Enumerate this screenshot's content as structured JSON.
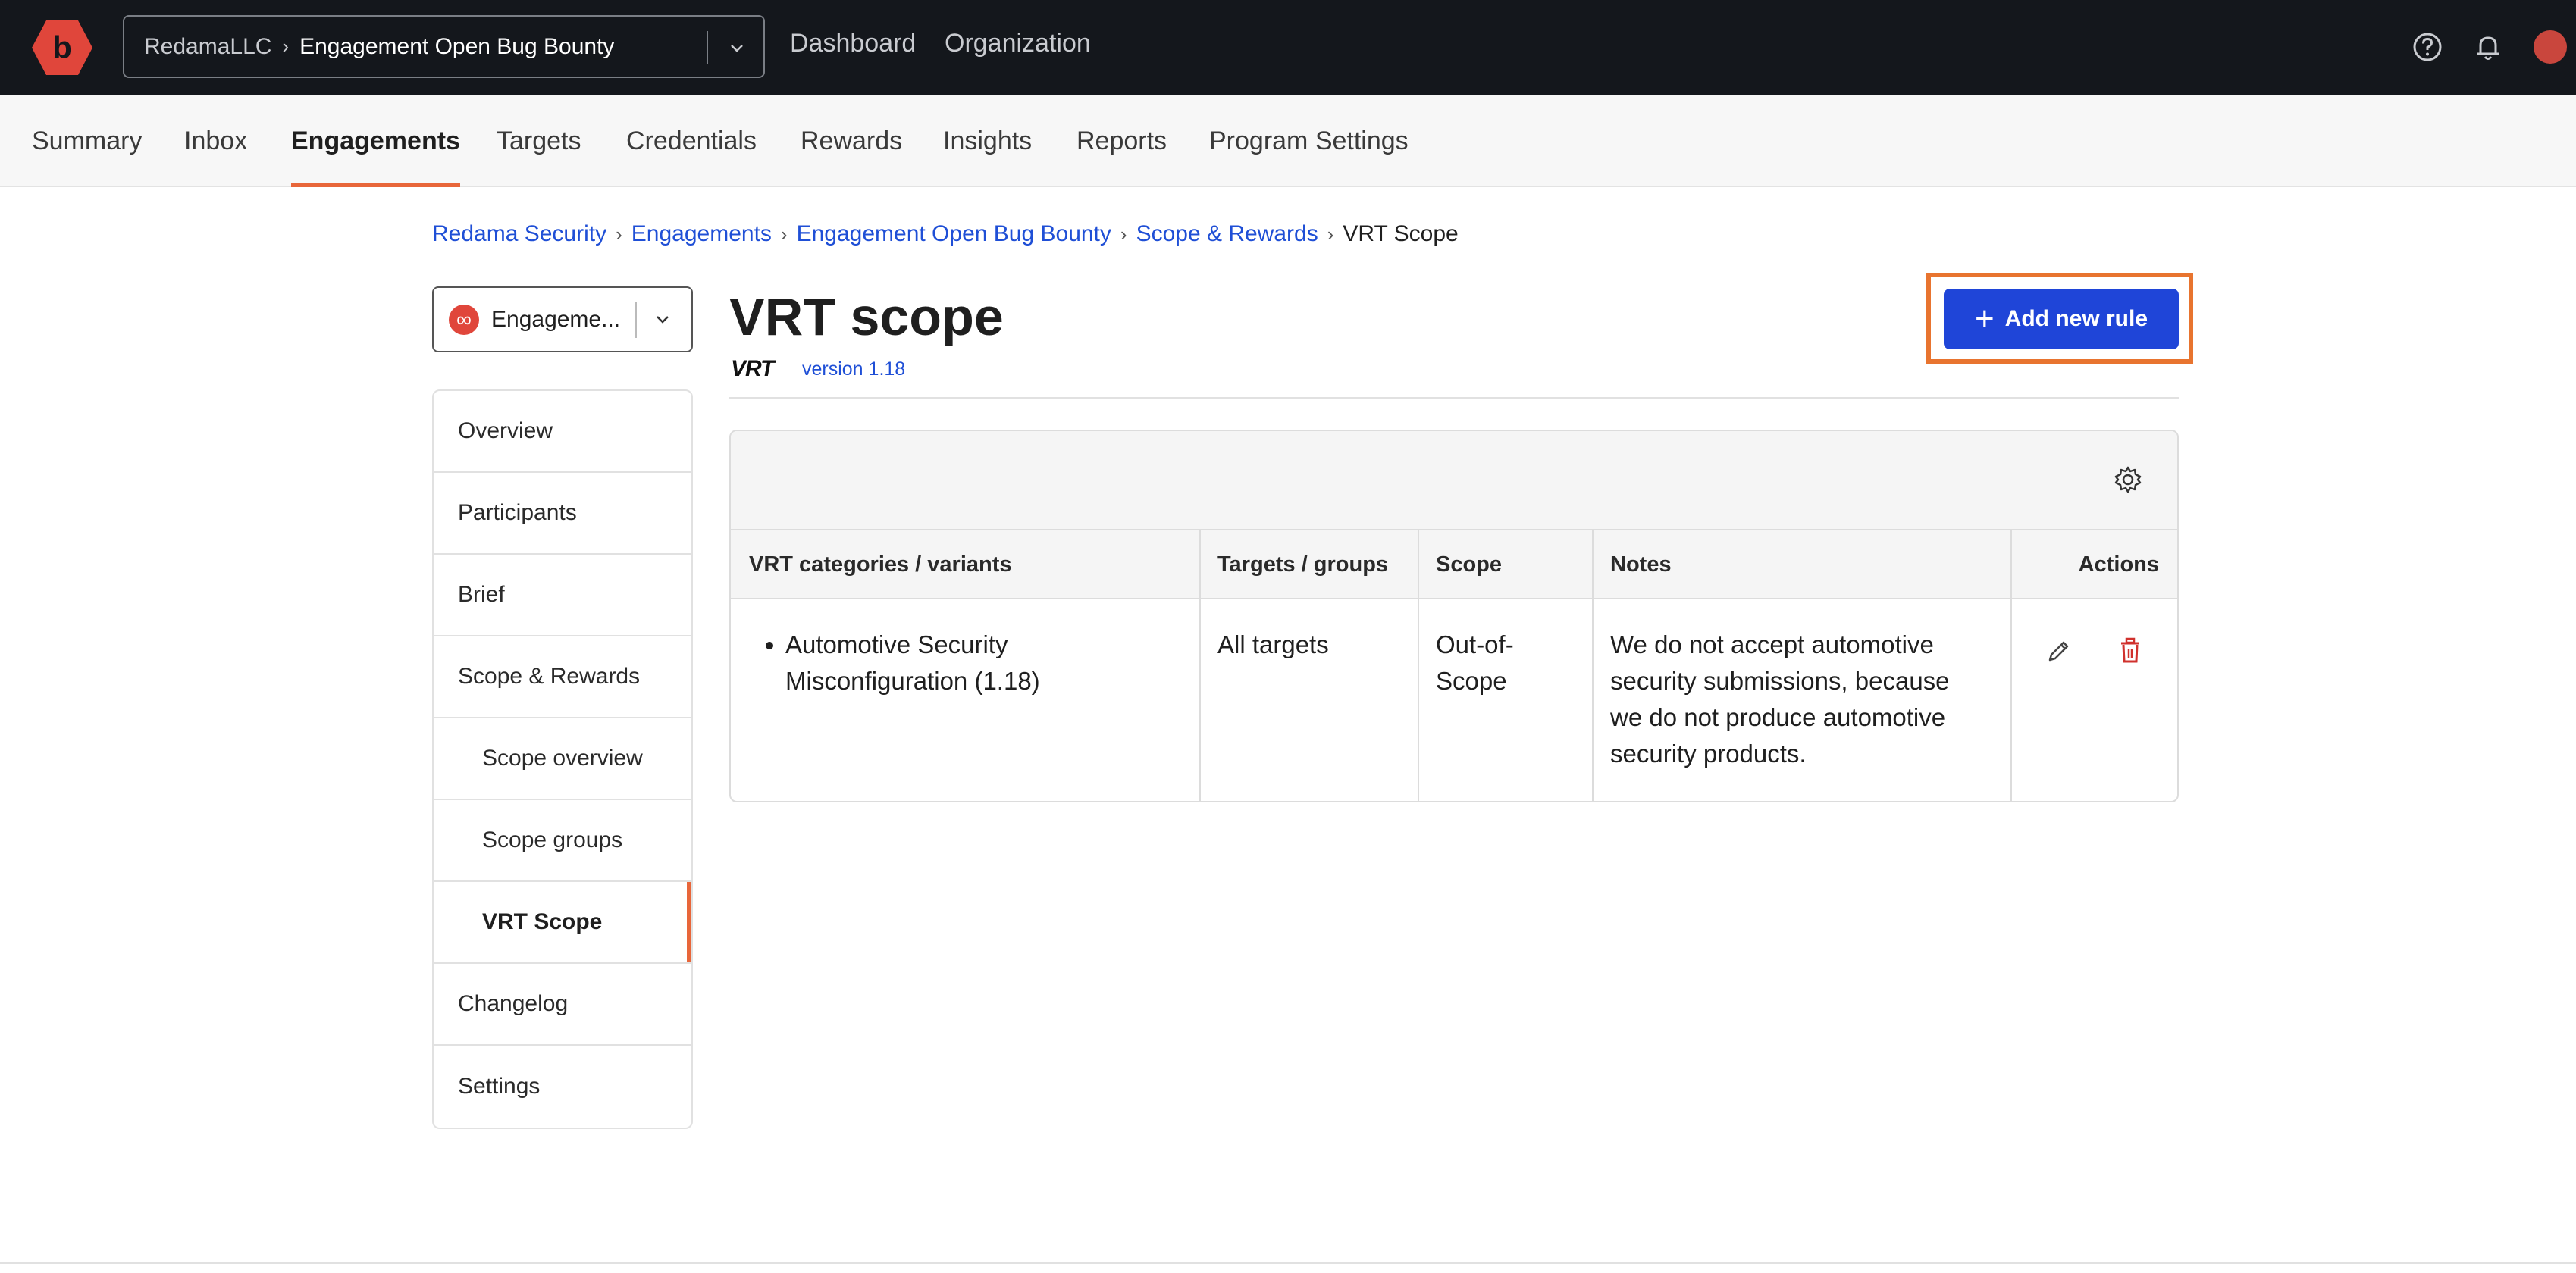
{
  "topbar": {
    "org": "RedamaLLC",
    "program": "Engagement Open Bug Bounty",
    "nav": [
      "Dashboard",
      "Organization"
    ],
    "icons": [
      "help-icon",
      "bell-icon",
      "avatar"
    ]
  },
  "subnav": {
    "items": [
      "Summary",
      "Inbox",
      "Engagements",
      "Targets",
      "Credentials",
      "Rewards",
      "Insights",
      "Reports",
      "Program Settings"
    ],
    "active": "Engagements"
  },
  "breadcrumb": {
    "items": [
      "Redama Security",
      "Engagements",
      "Engagement Open Bug Bounty",
      "Scope & Rewards"
    ],
    "current": "VRT Scope"
  },
  "engagement_select": {
    "label": "Engageme..."
  },
  "sidemenu": {
    "items": [
      "Overview",
      "Participants",
      "Brief",
      "Scope & Rewards",
      "Scope overview",
      "Scope groups",
      "VRT Scope",
      "Changelog",
      "Settings"
    ],
    "active": "VRT Scope"
  },
  "page": {
    "title": "VRT scope",
    "vrt_logo": "VRT",
    "version": "version 1.18",
    "add_button": "Add new rule"
  },
  "table": {
    "headers": [
      "VRT categories / variants",
      "Targets / groups",
      "Scope",
      "Notes",
      "Actions"
    ],
    "rows": [
      {
        "category_line1": "Automotive Security",
        "category_line2": "Misconfiguration (1.18)",
        "targets": "All targets",
        "scope_line1": "Out-of-",
        "scope_line2": "Scope",
        "notes_line1": "We do not accept automotive",
        "notes_line2": "security submissions, because",
        "notes_line3": "we do not produce automotive",
        "notes_line4": "security products."
      }
    ]
  },
  "colors": {
    "accent": "#e8663a",
    "primary": "#1f45d8",
    "danger": "#d0312d",
    "topbar": "#14171c"
  }
}
